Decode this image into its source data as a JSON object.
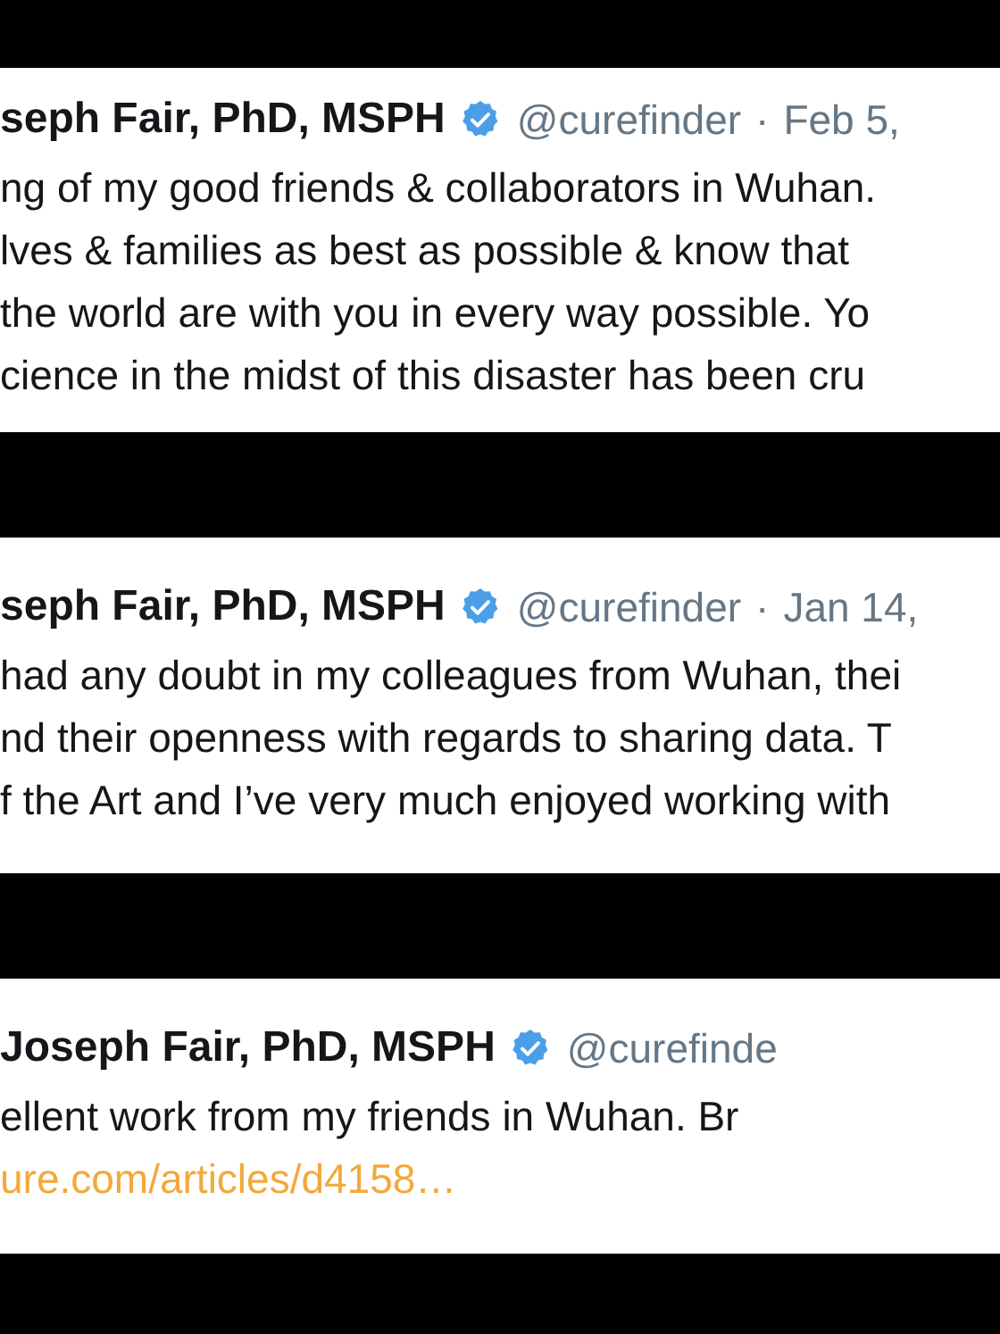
{
  "tweets": [
    {
      "name": "seph Fair, PhD, MSPH",
      "verified": true,
      "handle": "@curefinder",
      "separator": "·",
      "date": "Feb 5,",
      "lines": [
        {
          "kind": "text",
          "text": "ng of my good friends & collaborators in Wuhan."
        },
        {
          "kind": "text",
          "text": "lves & families as best as possible & know that"
        },
        {
          "kind": "text",
          "text": "the world are with you in every way possible. Yo"
        },
        {
          "kind": "text",
          "text": "cience in the midst of this disaster has been cru"
        }
      ]
    },
    {
      "name": "seph Fair, PhD, MSPH",
      "verified": true,
      "handle": "@curefinder",
      "separator": "·",
      "date": "Jan 14,",
      "lines": [
        {
          "kind": "text",
          "text": "had any doubt in my colleagues from Wuhan, thei"
        },
        {
          "kind": "text",
          "text": "nd their openness with regards to sharing data. T"
        },
        {
          "kind": "text",
          "text": "f the Art and I’ve very much enjoyed working with"
        }
      ]
    },
    {
      "name": "Joseph Fair, PhD, MSPH",
      "verified": true,
      "handle": "@curefinde",
      "lines": [
        {
          "kind": "text",
          "text": "ellent work from my friends in Wuhan. Br"
        },
        {
          "kind": "link",
          "text": "ure.com/articles/d4158…"
        }
      ]
    }
  ]
}
